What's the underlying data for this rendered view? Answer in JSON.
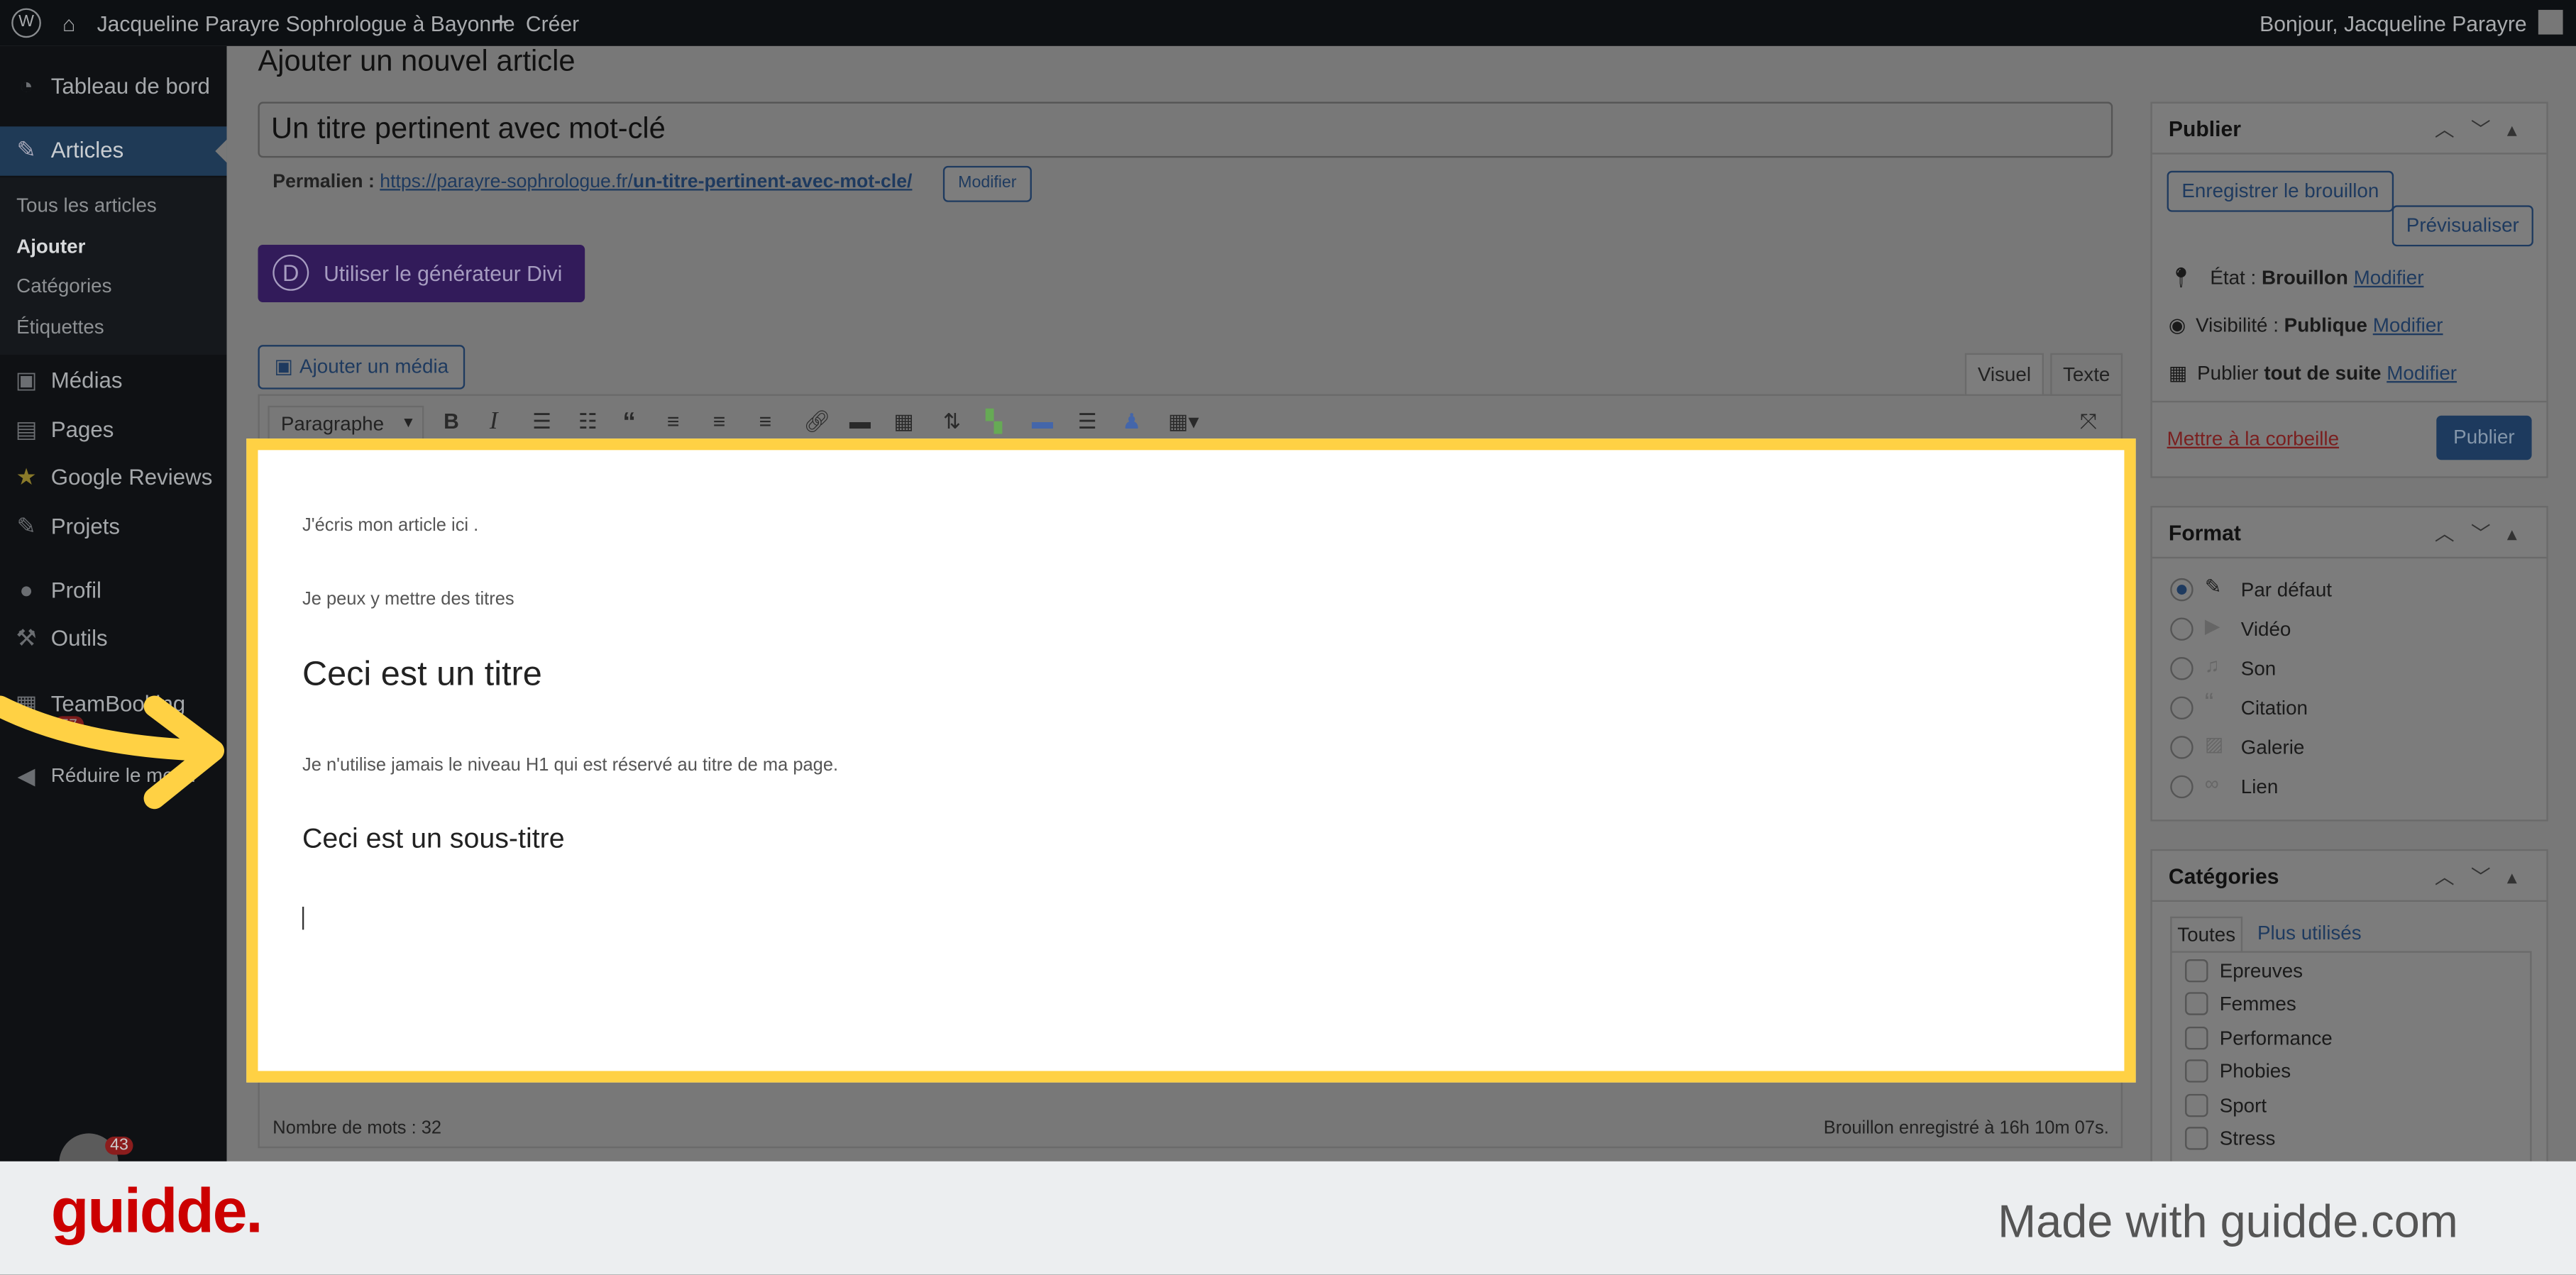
{
  "admin_bar": {
    "site_name": "Jacqueline Parayre Sophrologue à Bayonne",
    "create_label": "Créer",
    "greeting": "Bonjour, Jacqueline Parayre"
  },
  "sidebar": {
    "items": [
      {
        "label": "Tableau de bord",
        "icon": "dashboard-icon"
      },
      {
        "label": "Articles",
        "icon": "pin-icon",
        "active": true
      },
      {
        "label": "Médias",
        "icon": "media-icon"
      },
      {
        "label": "Pages",
        "icon": "pages-icon"
      },
      {
        "label": "Google Reviews",
        "icon": "star-icon"
      },
      {
        "label": "Projets",
        "icon": "pin-icon"
      },
      {
        "label": "Profil",
        "icon": "user-icon"
      },
      {
        "label": "Outils",
        "icon": "wrench-icon"
      },
      {
        "label": "TeamBooking",
        "icon": "calendar-icon",
        "badge": "57"
      },
      {
        "label": "Réduire le menu",
        "icon": "collapse-icon"
      }
    ],
    "submenu": [
      "Tous les articles",
      "Ajouter",
      "Catégories",
      "Étiquettes"
    ],
    "bottom_badge": "43"
  },
  "page": {
    "title": "Ajouter un nouvel article",
    "post_title": "Un titre pertinent avec mot-clé",
    "permalink_label": "Permalien :",
    "permalink_base": "https://parayre-sophrologue.fr/",
    "permalink_slug": "un-titre-pertinent-avec-mot-cle/",
    "permalink_edit": "Modifier",
    "divi_button": "Utiliser le générateur Divi",
    "divi_logo": "D",
    "add_media": "Ajouter un média"
  },
  "editor": {
    "tabs": [
      "Visuel",
      "Texte"
    ],
    "format_select": "Paragraphe",
    "content": [
      "J'écris mon article ici .",
      "Je peux y mettre des titres",
      "Ceci est un titre",
      "Je n'utilise jamais le niveau H1 qui est réservé au titre de ma page.",
      "Ceci est un sous-titre"
    ],
    "word_count": "Nombre de mots : 32",
    "draft_saved": "Brouillon enregistré à 16h 10m 07s.",
    "highlight_color": "#ffd144"
  },
  "publish": {
    "title": "Publier",
    "save_draft": "Enregistrer le brouillon",
    "preview": "Prévisualiser",
    "status_label": "État :",
    "status_value": "Brouillon",
    "visibility_label": "Visibilité :",
    "visibility_value": "Publique",
    "schedule_label": "Publier",
    "schedule_value": "tout de suite",
    "edit": "Modifier",
    "trash": "Mettre à la corbeille",
    "publish_button": "Publier"
  },
  "format": {
    "title": "Format",
    "options": [
      "Par défaut",
      "Vidéo",
      "Son",
      "Citation",
      "Galerie",
      "Lien"
    ],
    "selected": "Par défaut"
  },
  "categories": {
    "title": "Catégories",
    "tabs": [
      "Toutes",
      "Plus utilisés"
    ],
    "items": [
      "Epreuves",
      "Femmes",
      "Performance",
      "Phobies",
      "Sport",
      "Stress"
    ]
  },
  "footer": {
    "logo": "guidde.",
    "tagline": "Made with guidde.com",
    "brand_color": "#cc0000"
  }
}
